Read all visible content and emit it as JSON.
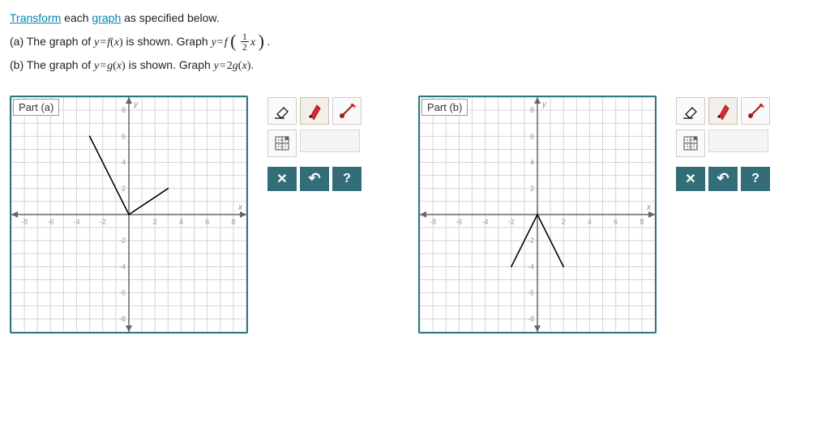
{
  "intro": {
    "word1": "Transform",
    "mid1": " each ",
    "word2": "graph",
    "rest1": " as specified below.",
    "line_a_pre": "(a) The graph of ",
    "line_a_eq1": "y=f(x)",
    "line_a_mid": " is shown. Graph ",
    "line_a_eq2_pre": "y=f",
    "line_a_frac_num": "1",
    "line_a_frac_den": "2",
    "line_a_eq2_post": "x",
    "line_b_pre": "(b) The graph of ",
    "line_b_eq1": "y=g(x)",
    "line_b_mid": " is shown. Graph ",
    "line_b_eq2": "y=2g(x)"
  },
  "parts": {
    "a": {
      "label": "Part (a)"
    },
    "b": {
      "label": "Part (b)"
    }
  },
  "axes": {
    "ticks_neg": [
      "-8",
      "-6",
      "-4",
      "-2"
    ],
    "ticks_pos": [
      "2",
      "4",
      "6",
      "8"
    ],
    "xlabel": "x",
    "ylabel": "y"
  },
  "tool_glyphs": {
    "clear": "✕",
    "undo": "↶",
    "help": "?"
  },
  "chart_data": [
    {
      "name": "Part (a) — f(x)",
      "type": "line",
      "series": [
        {
          "name": "f",
          "points": [
            [
              -3,
              6
            ],
            [
              0,
              0
            ],
            [
              3,
              2
            ]
          ]
        }
      ],
      "xlim": [
        -9,
        9
      ],
      "ylim": [
        -9,
        9
      ],
      "xlabel": "x",
      "ylabel": "y",
      "grid": true
    },
    {
      "name": "Part (b) — g(x)",
      "type": "line",
      "series": [
        {
          "name": "g",
          "points": [
            [
              -2,
              -4
            ],
            [
              0,
              0
            ],
            [
              2,
              -4
            ]
          ]
        }
      ],
      "xlim": [
        -9,
        9
      ],
      "ylim": [
        -9,
        9
      ],
      "xlabel": "x",
      "ylabel": "y",
      "grid": true
    }
  ]
}
